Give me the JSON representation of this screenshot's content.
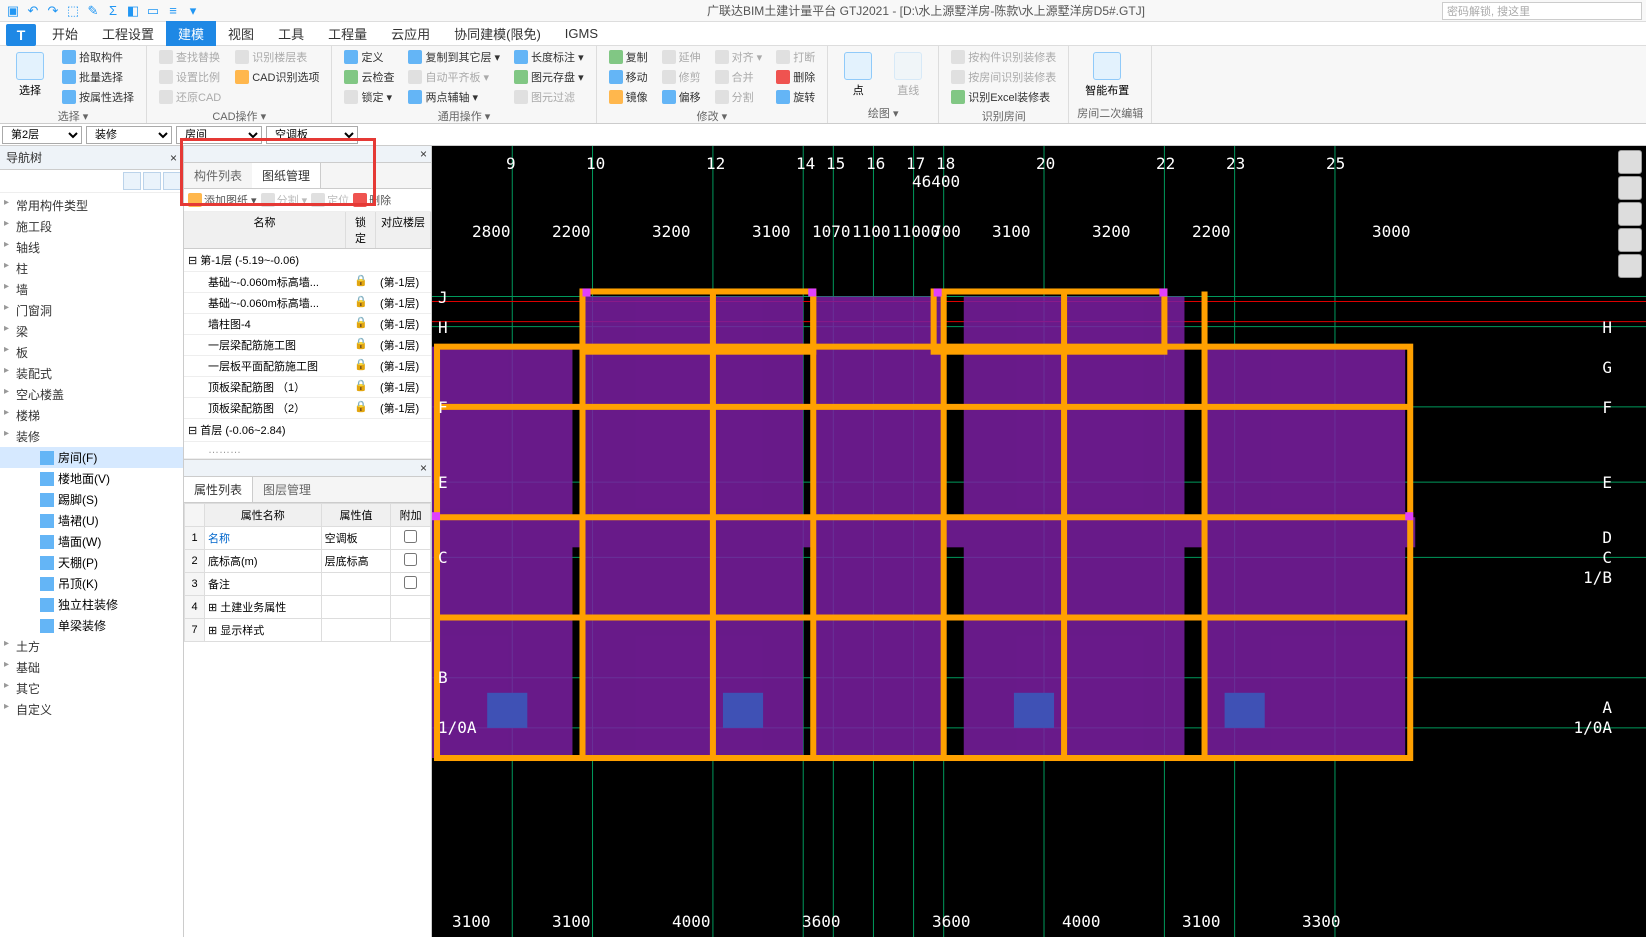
{
  "title": "广联达BIM土建计量平台 GTJ2021 - [D:\\水上源墅洋房-陈款\\水上源墅洋房D5#.GTJ]",
  "search_placeholder": "密码解锁, 搜这里",
  "tabs": [
    "开始",
    "工程设置",
    "建模",
    "视图",
    "工具",
    "工程量",
    "云应用",
    "协同建模(限免)",
    "IGMS"
  ],
  "active_tab": 2,
  "ribbon": {
    "g1": {
      "big": "选择",
      "items": [
        "拾取构件",
        "批量选择",
        "按属性选择"
      ],
      "label": "选择 ▾"
    },
    "g2": {
      "items": [
        "查找替换",
        "设置比例",
        "还原CAD",
        "识别楼层表",
        "CAD识别选项"
      ],
      "label": "CAD操作 ▾"
    },
    "g3": {
      "items": [
        "定义",
        "云检查",
        "锁定 ▾",
        "复制到其它层 ▾",
        "自动平齐板 ▾",
        "两点辅轴 ▾",
        "长度标注 ▾",
        "图元存盘 ▾",
        "图元过滤"
      ],
      "label": "通用操作 ▾"
    },
    "g4": {
      "items": [
        "复制",
        "移动",
        "镜像",
        "延伸",
        "修剪",
        "偏移",
        "对齐 ▾",
        "合并",
        "删除",
        "打断",
        "旋转"
      ],
      "label": "修改 ▾"
    },
    "g5": {
      "items": [
        "点",
        "直线"
      ],
      "label": "绘图 ▾"
    },
    "g6": {
      "items": [
        "按构件识别装修表",
        "按房间识别装修表",
        "识别Excel装修表"
      ],
      "label": "识别房间"
    },
    "g7": {
      "big": "智能布置",
      "label": "房间二次编辑"
    }
  },
  "selectors": {
    "floor": "第2层",
    "category": "装修",
    "sub": "房间",
    "comp": "空调板"
  },
  "nav": {
    "title": "导航树",
    "groups": [
      "常用构件类型",
      "施工段",
      "轴线",
      "柱",
      "墙",
      "门窗洞",
      "梁",
      "板",
      "装配式",
      "空心楼盖",
      "楼梯",
      "装修",
      "土方",
      "基础",
      "其它",
      "自定义"
    ],
    "decor_items": [
      {
        "label": "房间(F)",
        "key": "room",
        "selected": true
      },
      {
        "label": "楼地面(V)",
        "key": "floor"
      },
      {
        "label": "踢脚(S)",
        "key": "skirting"
      },
      {
        "label": "墙裙(U)",
        "key": "wainscot"
      },
      {
        "label": "墙面(W)",
        "key": "wall"
      },
      {
        "label": "天棚(P)",
        "key": "ceiling"
      },
      {
        "label": "吊顶(K)",
        "key": "suspend"
      },
      {
        "label": "独立柱装修",
        "key": "column"
      },
      {
        "label": "单梁装修",
        "key": "beam"
      }
    ]
  },
  "midtabs": {
    "t1": "构件列表",
    "t2": "图纸管理"
  },
  "dwg_toolbar": [
    "添加图纸 ▾",
    "分割 ▾",
    "定位",
    "删除"
  ],
  "dwg_header": [
    "名称",
    "锁定",
    "对应楼层"
  ],
  "dwg_floors": [
    {
      "name": "第-1层 (-5.19~-0.06)",
      "rows": [
        {
          "n": "基础~-0.060m标高墙...",
          "f": "(第-1层)"
        },
        {
          "n": "基础~-0.060m标高墙...",
          "f": "(第-1层)"
        },
        {
          "n": "墙柱图-4",
          "f": "(第-1层)"
        },
        {
          "n": "一层梁配筋施工图",
          "f": "(第-1层)"
        },
        {
          "n": "一层板平面配筋施工图",
          "f": "(第-1层)"
        },
        {
          "n": "顶板梁配筋图 （1）",
          "f": "(第-1层)"
        },
        {
          "n": "顶板梁配筋图 （2）",
          "f": "(第-1层)"
        }
      ]
    },
    {
      "name": "首层 (-0.06~2.84)",
      "rows": []
    }
  ],
  "prop_tabs": {
    "t1": "属性列表",
    "t2": "图层管理"
  },
  "prop_header": [
    "属性名称",
    "属性值",
    "附加"
  ],
  "prop_rows": [
    {
      "num": "1",
      "name": "名称",
      "val": "空调板"
    },
    {
      "num": "2",
      "name": "底标高(m)",
      "val": "层底标高"
    },
    {
      "num": "3",
      "name": "备注",
      "val": ""
    },
    {
      "num": "4",
      "name": "土建业务属性",
      "val": "",
      "exp": true
    },
    {
      "num": "7",
      "name": "显示样式",
      "val": "",
      "exp": true
    }
  ],
  "grid": {
    "top_axis": [
      "9",
      "10",
      "12",
      "14",
      "15",
      "16",
      "17",
      "18",
      "20",
      "22",
      "23",
      "25"
    ],
    "top_dim": "46400",
    "dims": [
      "2800",
      "2200",
      "3200",
      "3100",
      "1070",
      "1100",
      "11000",
      "700",
      "3100",
      "3200",
      "2200",
      "3000"
    ],
    "left_axis": [
      "J",
      "H",
      "F",
      "E",
      "C",
      "B",
      "1/0A"
    ],
    "right_axis": [
      "H",
      "G",
      "F",
      "E",
      "D",
      "C",
      "1/B",
      "A",
      "1/0A"
    ],
    "bottom": [
      "3100",
      "3100",
      "4000",
      "3600",
      "3600",
      "4000",
      "3100",
      "3300"
    ]
  }
}
